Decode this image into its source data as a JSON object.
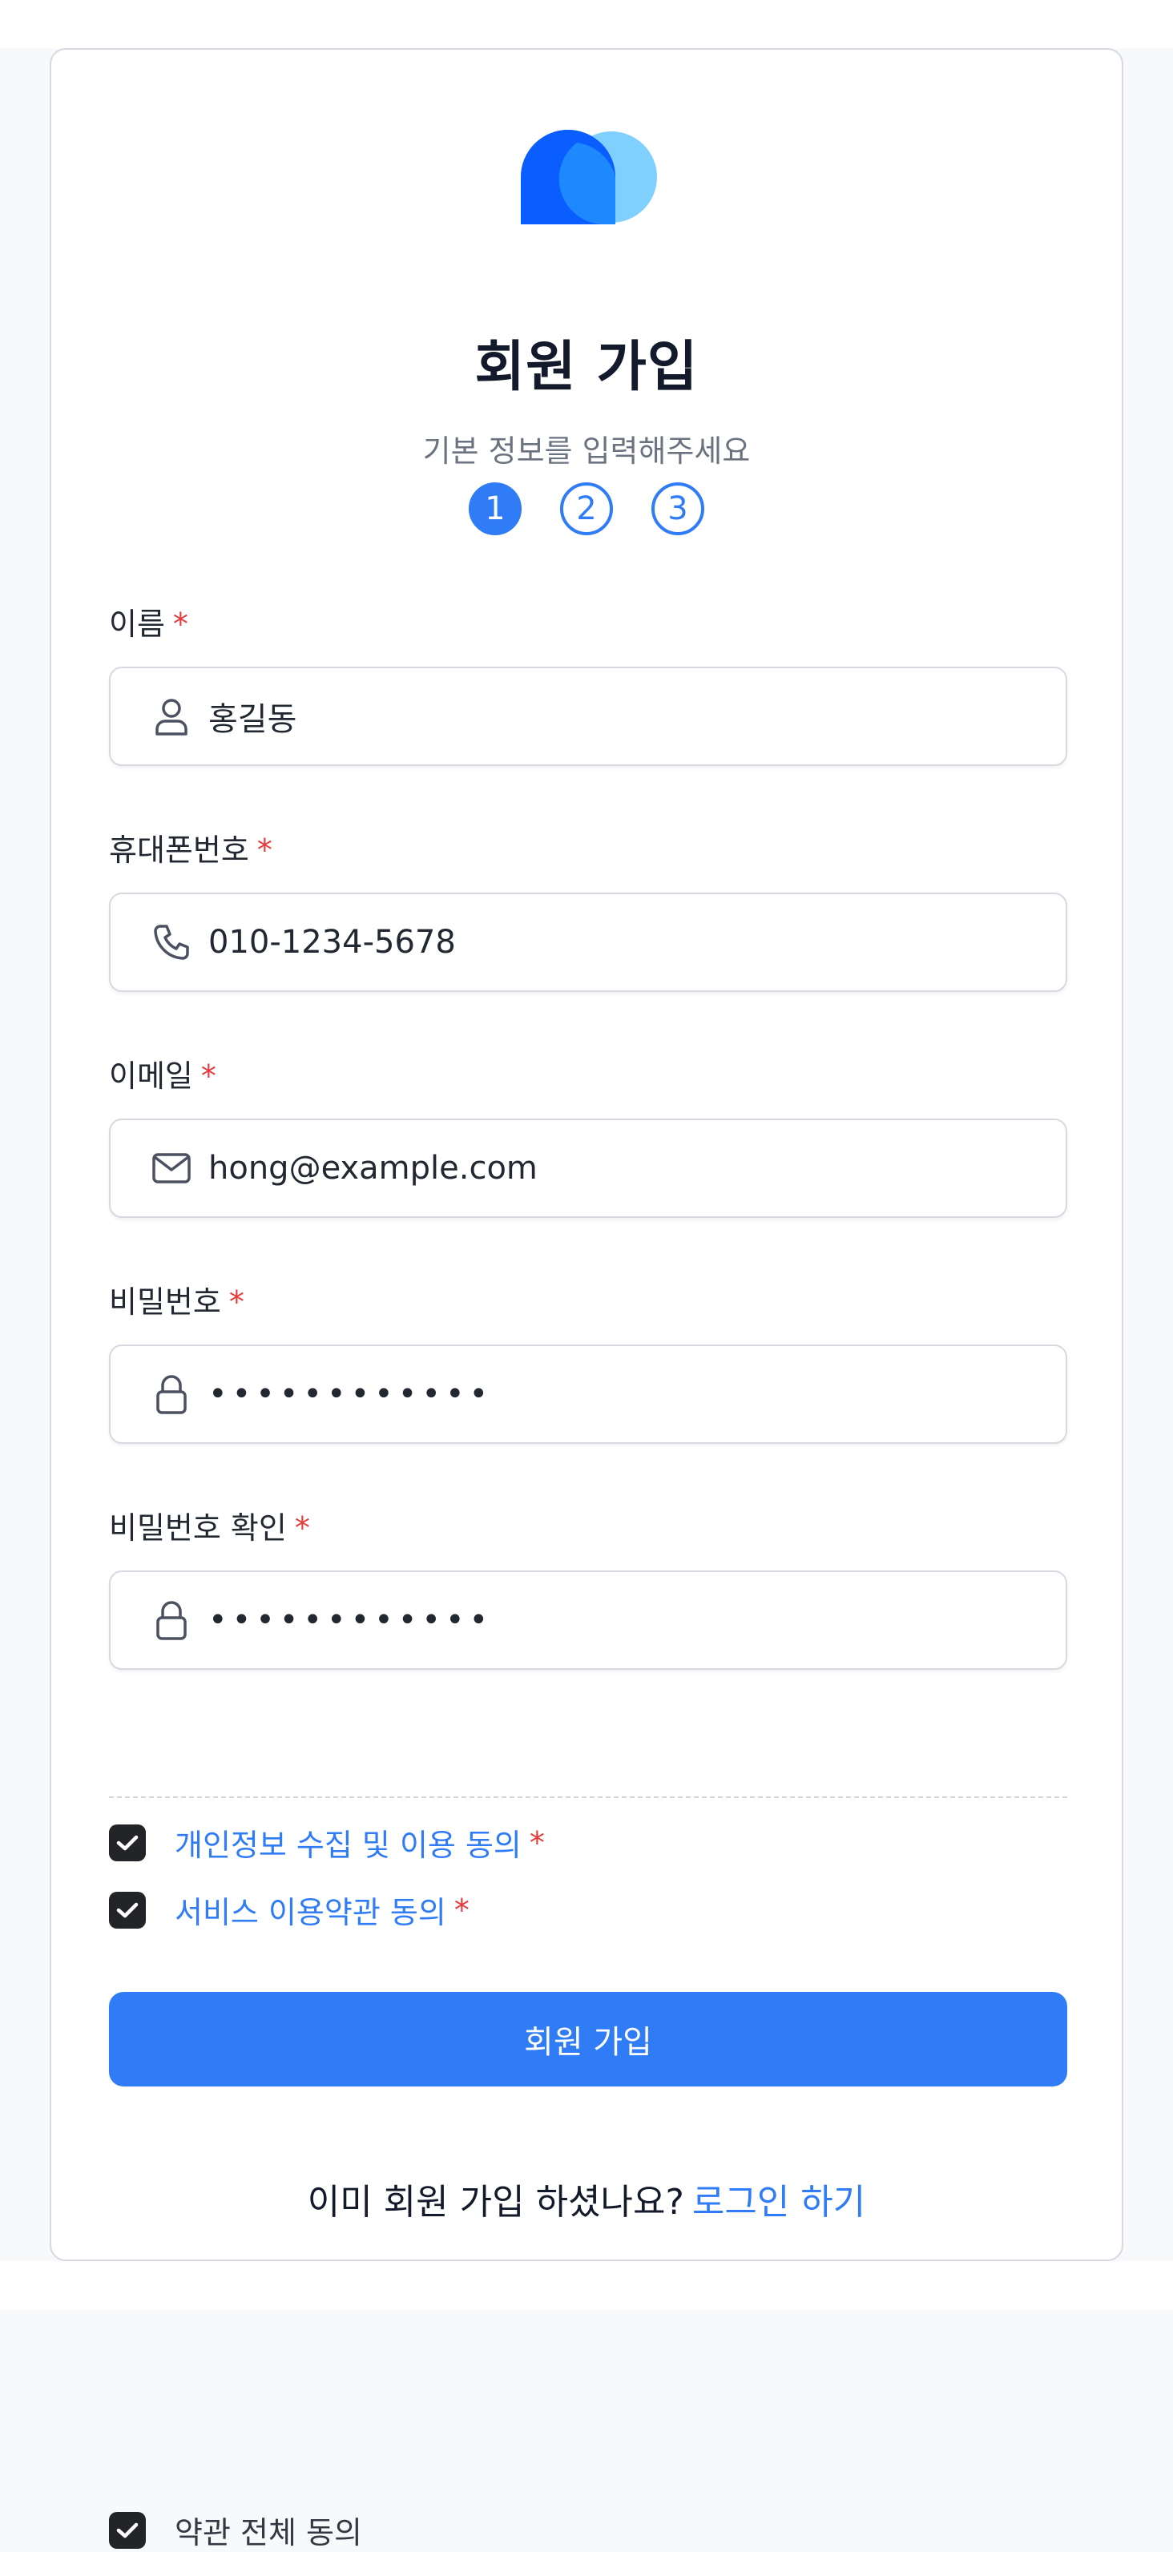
{
  "header": {
    "title": "회원 가입",
    "subtitle": "기본 정보를 입력해주세요"
  },
  "steps": [
    "1",
    "2",
    "3"
  ],
  "active_step": 1,
  "required_mark": "*",
  "fields": {
    "name": {
      "label": "이름",
      "value": "홍길동",
      "icon": "user-icon"
    },
    "phone": {
      "label": "휴대폰번호",
      "value": "010-1234-5678",
      "icon": "phone-icon"
    },
    "email": {
      "label": "이메일",
      "value": "hong@example.com",
      "icon": "mail-icon"
    },
    "password": {
      "label": "비밀번호",
      "value": "••••••••••••",
      "icon": "lock-icon"
    },
    "password_confirm": {
      "label": "비밀번호 확인",
      "value": "••••••••••••",
      "icon": "lock-icon"
    }
  },
  "agreements": {
    "all": {
      "label": "약관 전체 동의",
      "checked": true
    },
    "privacy": {
      "label": "개인정보 수집 및 이용 동의",
      "checked": true,
      "required": true
    },
    "service": {
      "label": "서비스 이용약관 동의",
      "checked": true,
      "required": true
    }
  },
  "submit_label": "회원 가입",
  "footer": {
    "question": "이미 회원 가입 하셨나요?",
    "link": "로그인 하기"
  },
  "colors": {
    "accent": "#2f7cf6",
    "required": "#e5393b",
    "logo_dark": "#0a5dff",
    "logo_light": "#7fd0ff"
  }
}
